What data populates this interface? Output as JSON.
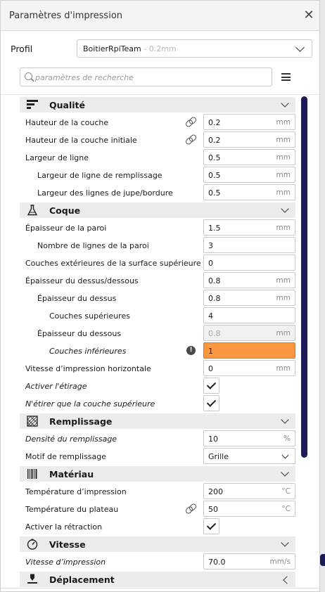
{
  "window": {
    "title": "Paramètres d'impression",
    "close": "✕"
  },
  "profile": {
    "label": "Profil",
    "name": "BoitierRpiTeam",
    "layer": " - 0.2mm"
  },
  "search": {
    "placeholder": "paramètres de recherche"
  },
  "categories": {
    "quality": "Qualité",
    "shell": "Coque",
    "infill": "Remplissage",
    "material": "Matériau",
    "speed": "Vitesse",
    "travel": "Déplacement"
  },
  "settings": [
    {
      "label": "Hauteur de la couche",
      "value": "0.2",
      "unit": "mm"
    },
    {
      "label": "Hauteur de la couche initiale",
      "value": "0.2",
      "unit": "mm"
    },
    {
      "label": "Largeur de ligne",
      "value": "0.5",
      "unit": "mm"
    },
    {
      "label": "Largeur de ligne de remplissage",
      "value": "0.5",
      "unit": "mm"
    },
    {
      "label": "Largeur des lignes de jupe/bordure",
      "value": "0.5",
      "unit": "mm"
    },
    {
      "label": "Épaisseur de la paroi",
      "value": "1.5",
      "unit": "mm"
    },
    {
      "label": "Nombre de lignes de la paroi",
      "value": "3",
      "unit": ""
    },
    {
      "label": "Couches extérieures de la surface supérieure",
      "value": "0",
      "unit": ""
    },
    {
      "label": "Épaisseur du dessus/dessous",
      "value": "0.8",
      "unit": "mm"
    },
    {
      "label": "Épaisseur du dessus",
      "value": "0.8",
      "unit": "mm"
    },
    {
      "label": "Couches supérieures",
      "value": "4",
      "unit": ""
    },
    {
      "label": "Épaisseur du dessous",
      "value": "0.8",
      "unit": "mm"
    },
    {
      "label": "Couches inférieures",
      "value": "1",
      "unit": ""
    },
    {
      "label": "Vitesse d’impression horizontale",
      "value": "0",
      "unit": "mm"
    },
    {
      "label": "Activer l'étirage",
      "checked": true
    },
    {
      "label": "N'étirer que la couche supérieure",
      "checked": true
    },
    {
      "label": "Densité du remplissage",
      "value": "10",
      "unit": "%"
    },
    {
      "label": "Motif de remplissage",
      "value": "Grille"
    },
    {
      "label": "Température d’impression",
      "value": "200",
      "unit": "°C"
    },
    {
      "label": "Température du plateau",
      "value": "50",
      "unit": "°C"
    },
    {
      "label": "Activer la rétraction",
      "checked": true
    },
    {
      "label": "Vitesse d’impression",
      "value": "70.0",
      "unit": "mm/s"
    }
  ],
  "icons": {
    "quality": "quality-bars-icon",
    "shell": "flask-icon",
    "infill": "infill-pattern-icon",
    "material": "filament-barcode-icon",
    "speed": "gauge-icon",
    "travel": "printhead-icon",
    "linked": "link-icon",
    "warning": "warning-icon"
  },
  "colors": {
    "accent_scrollbar": "#1b1b56",
    "warning_field": "#fb9641",
    "category_bg": "#ececec"
  }
}
